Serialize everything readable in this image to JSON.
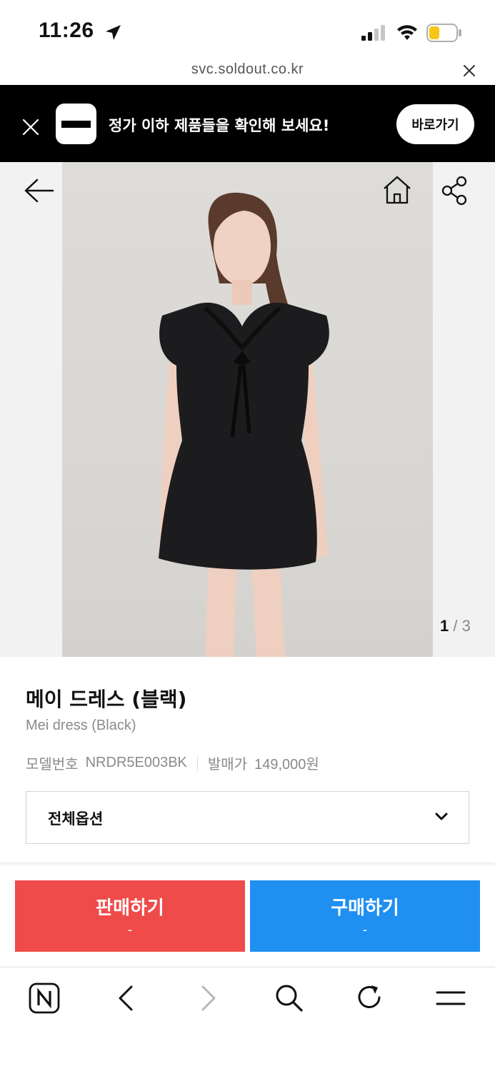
{
  "status_bar": {
    "time": "11:26",
    "icons": [
      "location-arrow-icon",
      "cellular-signal-icon",
      "wifi-icon",
      "battery-low-icon"
    ],
    "battery_color": "#f5c518"
  },
  "browser": {
    "url": "svc.soldout.co.kr"
  },
  "promo_banner": {
    "text": "정가 이하 제품들을 확인해 보세요!",
    "button_label": "바로가기",
    "background_color": "#000000"
  },
  "product": {
    "pager_current": "1",
    "pager_separator": "/",
    "pager_total": "3",
    "name_ko": "메이 드레스 (블랙)",
    "name_en": "Mei dress (Black)",
    "model_label": "모델번호",
    "model_value": "NRDR5E003BK",
    "release_price_label": "발매가",
    "release_price_value": "149,000원",
    "options_label": "전체옵션"
  },
  "actions": {
    "sell_label": "판매하기",
    "sell_price": "-",
    "sell_color": "#ef4b4a",
    "buy_label": "구매하기",
    "buy_price": "-",
    "buy_color": "#1f8ff2"
  },
  "toolbar": {
    "icons": [
      "naver-n-icon",
      "back-arrow-icon",
      "forward-arrow-icon",
      "search-icon",
      "refresh-icon",
      "menu-icon"
    ]
  }
}
